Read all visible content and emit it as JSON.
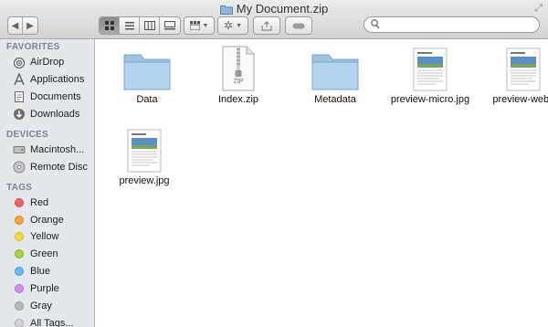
{
  "window": {
    "title": "My Document.zip"
  },
  "toolbar": {
    "nav": {
      "back": "◀",
      "forward": "▶"
    },
    "view_buttons": [
      "icon-view",
      "list-view",
      "column-view",
      "cover-flow-view"
    ],
    "arrange_button": "arrange",
    "action_button": "action",
    "share_button": "share",
    "tags_button": "edit-tags",
    "search": {
      "placeholder": "",
      "value": ""
    }
  },
  "sidebar": {
    "favorites_header": "FAVORITES",
    "favorites": [
      {
        "label": "AirDrop",
        "icon": "airdrop-icon"
      },
      {
        "label": "Applications",
        "icon": "applications-icon"
      },
      {
        "label": "Documents",
        "icon": "documents-icon"
      },
      {
        "label": "Downloads",
        "icon": "downloads-icon"
      }
    ],
    "devices_header": "DEVICES",
    "devices": [
      {
        "label": "Macintosh...",
        "icon": "hard-drive-icon"
      },
      {
        "label": "Remote Disc",
        "icon": "remote-disc-icon"
      }
    ],
    "tags_header": "TAGS",
    "tags": [
      {
        "label": "Red",
        "color": "#f0625f"
      },
      {
        "label": "Orange",
        "color": "#f5a53a"
      },
      {
        "label": "Yellow",
        "color": "#f5d83a"
      },
      {
        "label": "Green",
        "color": "#a7d83b"
      },
      {
        "label": "Blue",
        "color": "#71b6f0"
      },
      {
        "label": "Purple",
        "color": "#d68df0"
      },
      {
        "label": "Gray",
        "color": "#b9b9b9"
      },
      {
        "label": "All Tags...",
        "color": "#d2d2d2"
      }
    ]
  },
  "files": [
    {
      "name": "Data",
      "kind": "folder"
    },
    {
      "name": "Index.zip",
      "kind": "zip",
      "badge": "ZIP"
    },
    {
      "name": "Metadata",
      "kind": "folder"
    },
    {
      "name": "preview-micro.jpg",
      "kind": "image"
    },
    {
      "name": "preview-web.j",
      "kind": "image"
    },
    {
      "name": "preview.jpg",
      "kind": "image"
    }
  ]
}
